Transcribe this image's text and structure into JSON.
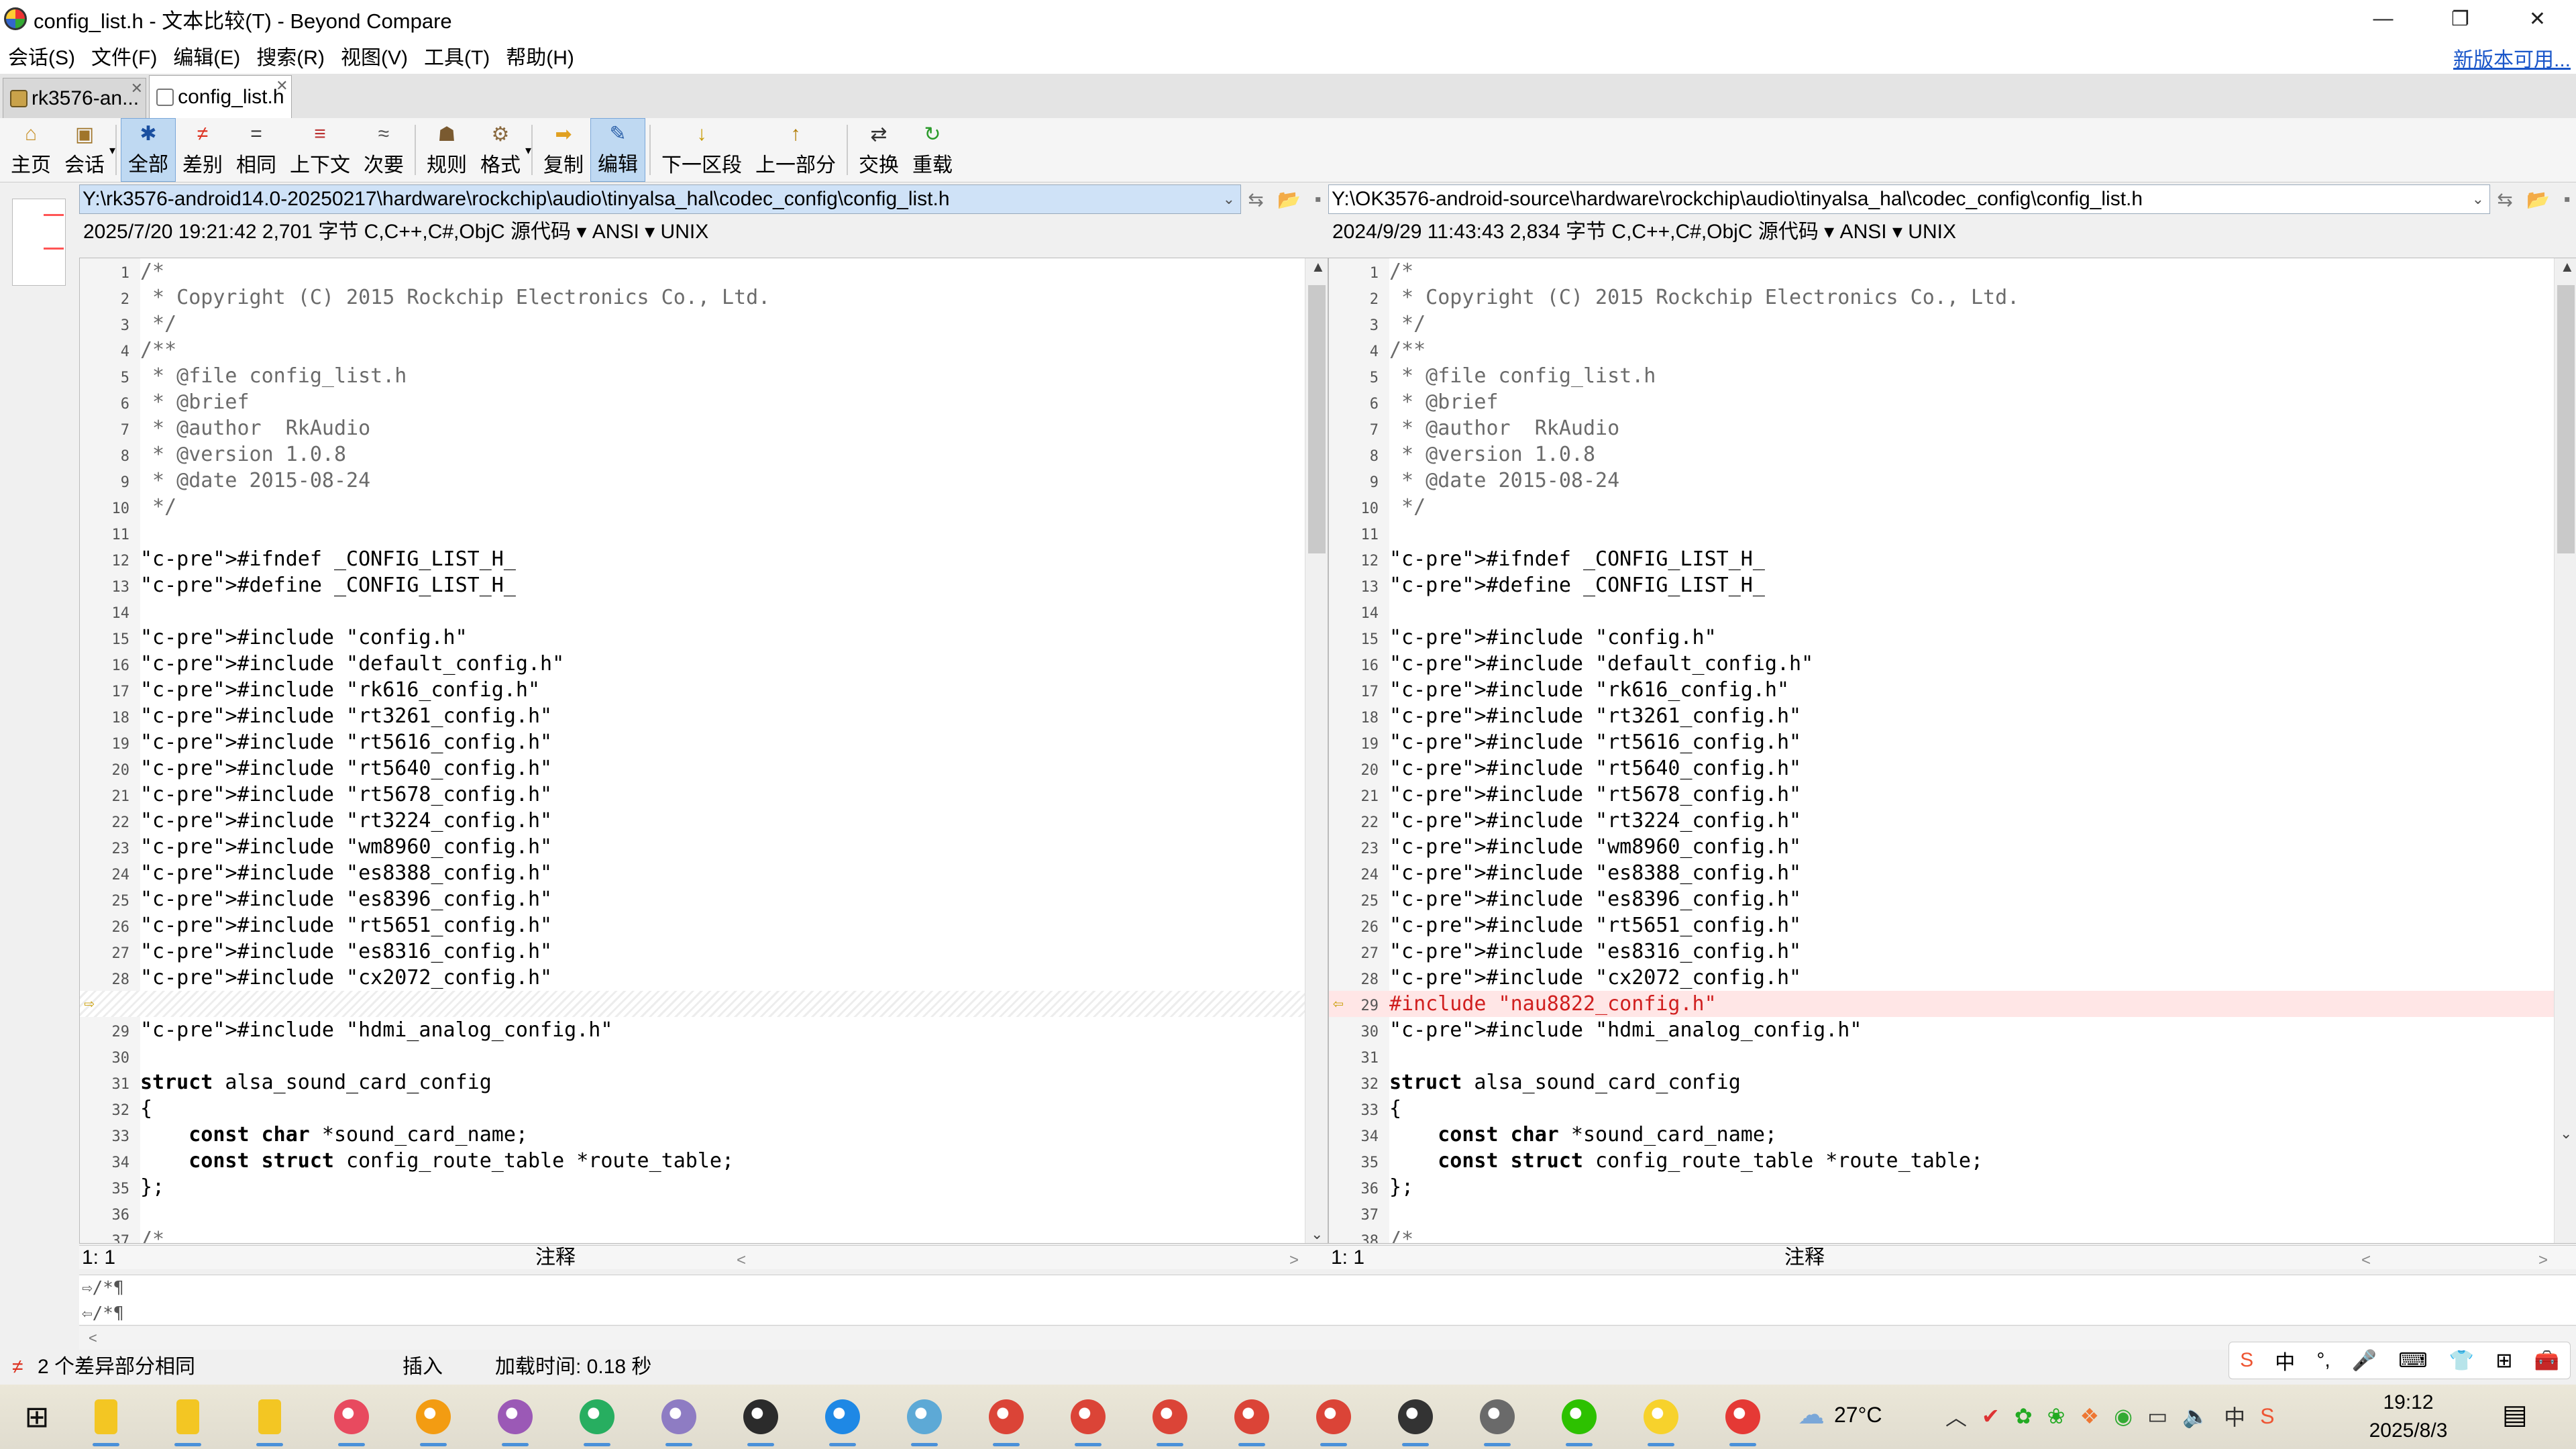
{
  "window": {
    "title": "config_list.h - 文本比较(T) - Beyond Compare",
    "min_glyph": "—",
    "max_glyph": "❐",
    "close_glyph": "✕"
  },
  "menu": {
    "items": [
      "会话(S)",
      "文件(F)",
      "编辑(E)",
      "搜索(R)",
      "视图(V)",
      "工具(T)",
      "帮助(H)"
    ],
    "new_version_link": "新版本可用..."
  },
  "tabs": [
    {
      "label": "rk3576-an...",
      "active": false
    },
    {
      "label": "config_list.h",
      "active": true
    }
  ],
  "toolbar": [
    {
      "label": "主页",
      "icon": "home-icon",
      "glyph": "⌂"
    },
    {
      "label": "会话",
      "icon": "session-icon",
      "glyph": "▣",
      "dropdown": true
    },
    {
      "label": "全部",
      "icon": "all-icon",
      "glyph": "✱",
      "selected": true
    },
    {
      "label": "差别",
      "icon": "diff-icon",
      "glyph": "≠"
    },
    {
      "label": "相同",
      "icon": "same-icon",
      "glyph": "="
    },
    {
      "label": "上下文",
      "icon": "context-icon",
      "glyph": "≡"
    },
    {
      "label": "次要",
      "icon": "minor-icon",
      "glyph": "≈"
    },
    {
      "label": "规则",
      "icon": "rules-icon",
      "glyph": "☗"
    },
    {
      "label": "格式",
      "icon": "format-icon",
      "glyph": "⚙",
      "dropdown": true
    },
    {
      "label": "复制",
      "icon": "copy-icon",
      "glyph": "➡"
    },
    {
      "label": "编辑",
      "icon": "edit-icon",
      "glyph": "✎",
      "selected": true
    },
    {
      "label": "下一区段",
      "icon": "next-section-icon",
      "glyph": "↓"
    },
    {
      "label": "上一部分",
      "icon": "prev-section-icon",
      "glyph": "↑"
    },
    {
      "label": "交换",
      "icon": "swap-icon",
      "glyph": "⇄"
    },
    {
      "label": "重载",
      "icon": "reload-icon",
      "glyph": "↻"
    }
  ],
  "left": {
    "path": "Y:\\rk3576-android14.0-20250217\\hardware\\rockchip\\audio\\tinyalsa_hal\\codec_config\\config_list.h",
    "info": "2025/7/20 19:21:42  2,701 字节  C,C++,C#,ObjC 源代码 ▾ ANSI ▾ UNIX",
    "cursor": "1: 1",
    "mode": "注释"
  },
  "right": {
    "path": "Y:\\OK3576-android-source\\hardware\\rockchip\\audio\\tinyalsa_hal\\codec_config\\config_list.h",
    "info": "2024/9/29 11:43:43  2,834 字节  C,C++,C#,ObjC 源代码 ▾ ANSI ▾ UNIX",
    "cursor": "1: 1",
    "mode": "注释"
  },
  "code_common_head": [
    "/*",
    " * Copyright (C) 2015 Rockchip Electronics Co., Ltd.",
    " */",
    "/**",
    " * @file config_list.h",
    " * @brief",
    " * @author  RkAudio",
    " * @version 1.0.8",
    " * @date 2015-08-24",
    " */",
    "",
    "#ifndef _CONFIG_LIST_H_",
    "#define _CONFIG_LIST_H_",
    "",
    "#include \"config.h\"",
    "#include \"default_config.h\"",
    "#include \"rk616_config.h\"",
    "#include \"rt3261_config.h\"",
    "#include \"rt5616_config.h\"",
    "#include \"rt5640_config.h\"",
    "#include \"rt5678_config.h\"",
    "#include \"rt3224_config.h\"",
    "#include \"wm8960_config.h\"",
    "#include \"es8388_config.h\"",
    "#include \"es8396_config.h\"",
    "#include \"rt5651_config.h\"",
    "#include \"es8316_config.h\"",
    "#include \"cx2072_config.h\""
  ],
  "code_diff_line": "#include \"nau8822_config.h\"",
  "code_common_tail": [
    "#include \"hdmi_analog_config.h\"",
    "",
    "struct alsa_sound_card_config",
    "{",
    "    const char *sound_card_name;",
    "    const struct config_route_table *route_table;",
    "};",
    "",
    "/*"
  ],
  "mini_lines": [
    "⇨/*¶",
    "⇦/*¶"
  ],
  "status": {
    "diff_summary": "2 个差异部分相同",
    "insert_mode": "插入",
    "load_time": "加载时间: 0.18 秒"
  },
  "ime": [
    "S",
    "中",
    "°,",
    "🎤",
    "⌨",
    "👕",
    "⊞",
    "🧰"
  ],
  "taskbar": {
    "weather": "27°C",
    "time": "19:12",
    "date": "2025/8/3",
    "apps": [
      {
        "name": "windows-start",
        "color": "#1a1a1a"
      },
      {
        "name": "file-explorer-1",
        "color": "#f3c623"
      },
      {
        "name": "file-explorer-2",
        "color": "#f3c623"
      },
      {
        "name": "file-explorer-3",
        "color": "#f3c623"
      },
      {
        "name": "colorful-app-1",
        "color": "#e84a5f"
      },
      {
        "name": "colorful-app-2",
        "color": "#f39c12"
      },
      {
        "name": "colorful-app-3",
        "color": "#9b59b6"
      },
      {
        "name": "colorful-app-4",
        "color": "#27ae60"
      },
      {
        "name": "paint-app",
        "color": "#8e7cc3"
      },
      {
        "name": "ultraedit",
        "color": "#2b2b2b"
      },
      {
        "name": "browser-swirl",
        "color": "#1e88e5"
      },
      {
        "name": "folder-blue",
        "color": "#5da9d6"
      },
      {
        "name": "chrome-1",
        "color": "#db4437"
      },
      {
        "name": "chrome-2",
        "color": "#db4437"
      },
      {
        "name": "chrome-3",
        "color": "#db4437"
      },
      {
        "name": "chrome-4",
        "color": "#db4437"
      },
      {
        "name": "chrome-5",
        "color": "#db4437"
      },
      {
        "name": "beyond-compare",
        "color": "#333333"
      },
      {
        "name": "settings-app",
        "color": "#6a6a6a"
      },
      {
        "name": "wechat",
        "color": "#2dc100"
      },
      {
        "name": "player-app",
        "color": "#f7d22c"
      },
      {
        "name": "red-swirl-app",
        "color": "#e53935"
      }
    ]
  },
  "colors": {
    "selected_path_bg": "#cfe2f7",
    "diff_line_bg": "#ffe6e6",
    "diff_text": "#d01f1f",
    "preprocessor": "#8a1c1c",
    "string": "#0b7a4a",
    "comment": "#6b6b6b"
  }
}
